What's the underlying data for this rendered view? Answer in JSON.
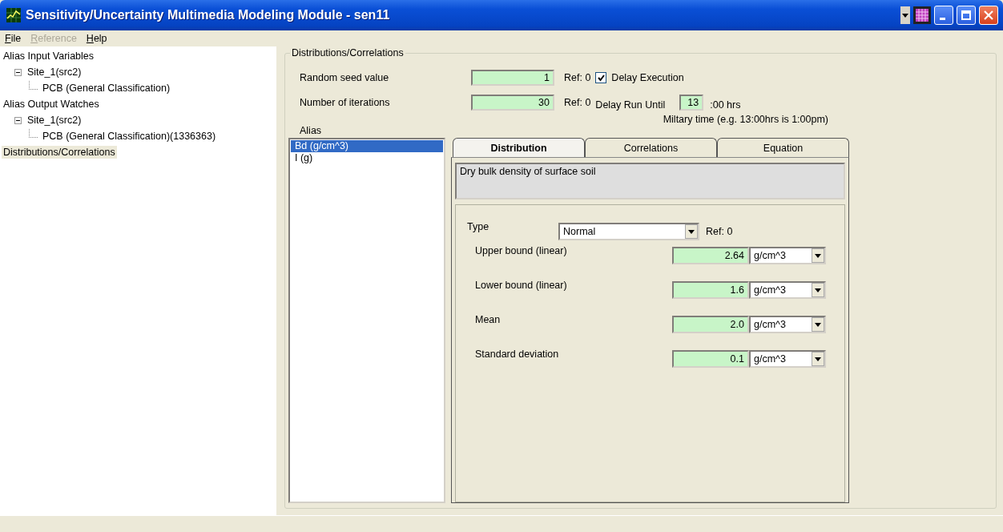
{
  "window": {
    "title": "Sensitivity/Uncertainty Multimedia Modeling Module - sen11"
  },
  "menu": [
    {
      "label": "File",
      "disabled": false
    },
    {
      "label": "Reference",
      "disabled": true
    },
    {
      "label": "Help",
      "disabled": false
    }
  ],
  "tree": [
    {
      "label": "Alias Input Variables",
      "selected": false,
      "children": [
        {
          "label": "Site_1(src2)",
          "selected": false,
          "expanded": true,
          "children": [
            {
              "label": "PCB (General Classification)",
              "selected": false
            }
          ]
        }
      ]
    },
    {
      "label": "Alias Output Watches",
      "selected": false,
      "children": [
        {
          "label": "Site_1(src2)",
          "selected": false,
          "expanded": true,
          "children": [
            {
              "label": "PCB (General Classification)(1336363)",
              "selected": false
            }
          ]
        }
      ]
    },
    {
      "label": "Distributions/Correlations",
      "selected": true
    }
  ],
  "group": {
    "title": "Distributions/Correlations",
    "seed": {
      "label": "Random seed value",
      "value": "1",
      "ref": "Ref: 0"
    },
    "iterations": {
      "label": "Number of iterations",
      "value": "30",
      "ref": "Ref: 0"
    },
    "delay_execution": {
      "label": "Delay Execution",
      "checked": true
    },
    "delay_run": {
      "label": "Delay Run Until",
      "value": "13",
      "suffix": ":00 hrs",
      "note": "Miltary time (e.g. 13:00hrs is 1:00pm)"
    },
    "alias": {
      "label": "Alias",
      "items": [
        {
          "label": "Bd  (g/cm^3)",
          "selected": true
        },
        {
          "label": "I  (g)",
          "selected": false
        }
      ]
    },
    "tabs": [
      {
        "label": "Distribution",
        "selected": true
      },
      {
        "label": "Correlations",
        "selected": false
      },
      {
        "label": "Equation",
        "selected": false
      }
    ],
    "description": "Dry bulk density of surface soil",
    "type": {
      "label": "Type",
      "value": "Normal",
      "ref": "Ref: 0"
    },
    "parameters": [
      {
        "label": "Upper bound (linear)",
        "value": "2.64",
        "unit": "g/cm^3"
      },
      {
        "label": "Lower bound (linear)",
        "value": "1.6",
        "unit": "g/cm^3"
      },
      {
        "label": "Mean",
        "value": "2.0",
        "unit": "g/cm^3"
      },
      {
        "label": "Standard deviation",
        "value": "0.1",
        "unit": "g/cm^3"
      }
    ]
  }
}
